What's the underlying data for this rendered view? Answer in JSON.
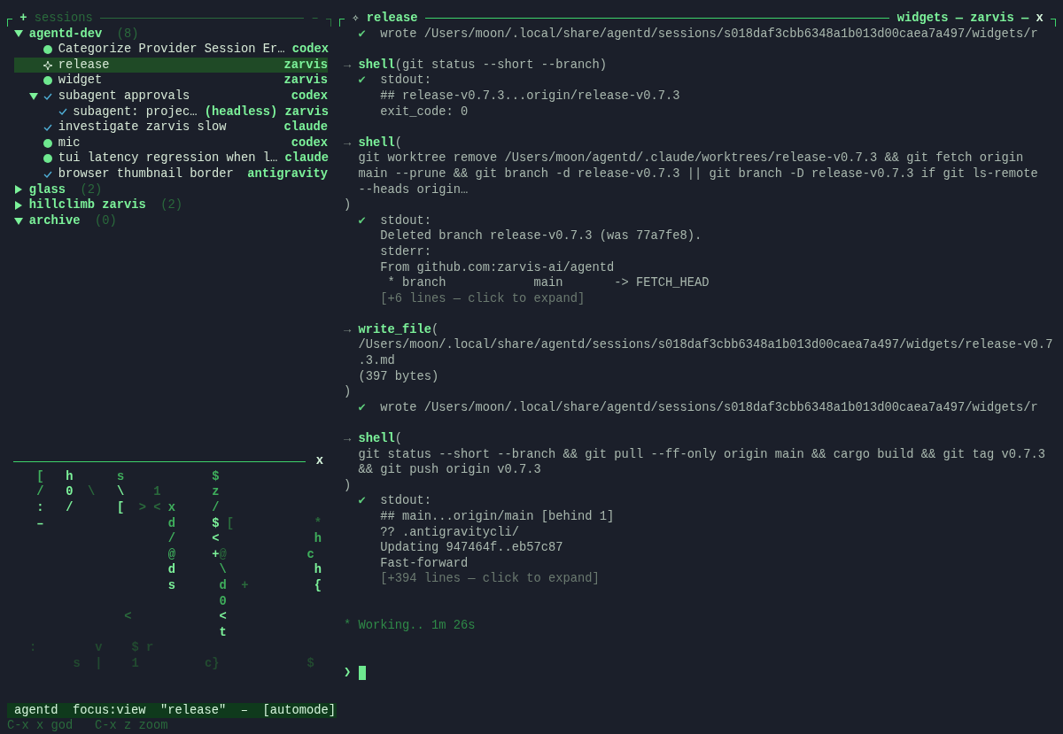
{
  "sessions": {
    "add": "+",
    "title": "sessions",
    "collapse": "–",
    "groups": [
      {
        "name": "agentd-dev",
        "count": "(8)",
        "expanded": true,
        "items": [
          {
            "kind": "running",
            "title": "Categorize Provider Session Er…",
            "agent": "codex",
            "selected": false
          },
          {
            "kind": "active",
            "title": "release",
            "agent": "zarvis",
            "selected": true
          },
          {
            "kind": "running",
            "title": "widget",
            "agent": "zarvis",
            "selected": false
          },
          {
            "kind": "done",
            "title": "subagent approvals",
            "agent": "codex",
            "selected": false,
            "expanded": true,
            "children": [
              {
                "kind": "done",
                "title": "subagent: projec…",
                "tag": "(headless)",
                "agent": "zarvis",
                "selected": false
              }
            ]
          },
          {
            "kind": "done",
            "title": "investigate zarvis slow",
            "agent": "claude",
            "selected": false
          },
          {
            "kind": "running",
            "title": "mic",
            "agent": "codex",
            "selected": false
          },
          {
            "kind": "running",
            "title": "tui latency regression when l…",
            "agent": "claude",
            "selected": false
          },
          {
            "kind": "done",
            "title": "browser thumbnail border",
            "agent": "antigravity",
            "selected": false
          }
        ]
      },
      {
        "name": "glass",
        "count": "(2)",
        "expanded": false
      },
      {
        "name": "hillclimb zarvis",
        "count": "(2)",
        "expanded": false
      },
      {
        "name": "archive",
        "count": "(0)",
        "expanded": true
      }
    ]
  },
  "rain": {
    "close": "x",
    "rows": [
      [
        "",
        "",
        "",
        "",
        "",
        {
          "char": "[",
          "color": "#3fae5c"
        },
        "",
        "",
        "",
        {
          "char": "h",
          "color": "#7cf29a"
        },
        "",
        "",
        "",
        "",
        "",
        "",
        {
          "char": "s",
          "color": "#3fae5c"
        },
        "",
        "",
        "",
        "",
        "",
        "",
        "",
        "",
        "",
        "",
        "",
        "",
        {
          "char": "$",
          "color": "#3fae5c"
        }
      ],
      [
        "",
        "",
        "",
        "",
        "",
        {
          "char": "/",
          "color": "#3fae5c"
        },
        "",
        "",
        "",
        {
          "char": "0",
          "color": "#7cf29a"
        },
        "",
        "",
        {
          "char": "\\",
          "color": "#2a6a3c"
        },
        "",
        "",
        "",
        {
          "char": "\\",
          "color": "#7cf29a"
        },
        "",
        "",
        "",
        "",
        {
          "char": "1",
          "color": "#2a6a3c"
        },
        "",
        "",
        "",
        "",
        "",
        "",
        "",
        {
          "char": "z",
          "color": "#3fae5c"
        }
      ],
      [
        "",
        "",
        "",
        "",
        "",
        {
          "char": ":",
          "color": "#7cf29a"
        },
        "",
        "",
        "",
        {
          "char": "/",
          "color": "#7cf29a"
        },
        "",
        "",
        "",
        "",
        "",
        "",
        {
          "char": "[",
          "color": "#7cf29a"
        },
        "",
        "",
        {
          "char": ">",
          "color": "#2a6a3c"
        },
        "",
        {
          "char": "<",
          "color": "#2a6a3c"
        },
        "",
        {
          "char": "x",
          "color": "#3fae5c"
        },
        "",
        "",
        "",
        "",
        "",
        {
          "char": "/",
          "color": "#3fae5c"
        }
      ],
      [
        "",
        "",
        "",
        "",
        "",
        {
          "char": "–",
          "color": "#7cf29a"
        },
        "",
        "",
        "",
        "",
        "",
        "",
        "",
        "",
        "",
        "",
        "",
        "",
        "",
        "",
        "",
        "",
        "",
        {
          "char": "d",
          "color": "#3fae5c"
        },
        "",
        "",
        "",
        "",
        "",
        {
          "char": "$",
          "color": "#7cf29a"
        },
        "",
        {
          "char": "[",
          "color": "#2a6a3c"
        },
        "",
        "",
        "",
        "",
        "",
        "",
        "",
        "",
        "",
        "",
        "",
        {
          "char": "*",
          "color": "#2a6a3c"
        }
      ],
      [
        "",
        "",
        "",
        "",
        "",
        "",
        "",
        "",
        "",
        "",
        "",
        "",
        "",
        "",
        "",
        "",
        "",
        "",
        "",
        "",
        "",
        "",
        "",
        {
          "char": "/",
          "color": "#3fae5c"
        },
        "",
        "",
        "",
        "",
        "",
        {
          "char": "<",
          "color": "#7cf29a"
        },
        "",
        "",
        "",
        "",
        "",
        "",
        "",
        "",
        "",
        "",
        "",
        "",
        "",
        {
          "char": "h",
          "color": "#3fae5c"
        }
      ],
      [
        "",
        "",
        "",
        "",
        "",
        "",
        "",
        "",
        "",
        "",
        "",
        "",
        "",
        "",
        "",
        "",
        "",
        "",
        "",
        "",
        "",
        "",
        "",
        {
          "char": "@",
          "color": "#3fae5c"
        },
        "",
        "",
        "",
        "",
        "",
        {
          "char": "+",
          "color": "#7cf29a"
        },
        {
          "char": "@",
          "color": "#2a6a3c"
        },
        "",
        "",
        "",
        "",
        "",
        "",
        "",
        "",
        "",
        "",
        "",
        {
          "char": "c",
          "color": "#3fae5c"
        }
      ],
      [
        "",
        "",
        "",
        "",
        "",
        "",
        "",
        "",
        "",
        "",
        "",
        "",
        "",
        "",
        "",
        "",
        "",
        "",
        "",
        "",
        "",
        "",
        "",
        {
          "char": "d",
          "color": "#7cf29a"
        },
        "",
        "",
        "",
        "",
        "",
        "",
        {
          "char": "\\",
          "color": "#3fae5c"
        },
        "",
        "",
        "",
        "",
        "",
        "",
        "",
        "",
        "",
        "",
        "",
        "",
        {
          "char": "h",
          "color": "#7cf29a"
        }
      ],
      [
        "",
        "",
        "",
        "",
        "",
        "",
        "",
        "",
        "",
        "",
        "",
        "",
        "",
        "",
        "",
        "",
        "",
        "",
        "",
        "",
        "",
        "",
        "",
        {
          "char": "s",
          "color": "#7cf29a"
        },
        "",
        "",
        "",
        "",
        "",
        "",
        {
          "char": "d",
          "color": "#3fae5c"
        },
        "",
        "",
        {
          "char": "+",
          "color": "#2a6a3c"
        },
        "",
        "",
        "",
        "",
        "",
        "",
        "",
        "",
        "",
        {
          "char": "{",
          "color": "#7cf29a"
        }
      ],
      [
        "",
        "",
        "",
        "",
        "",
        "",
        "",
        "",
        "",
        "",
        "",
        "",
        "",
        "",
        "",
        "",
        "",
        "",
        "",
        "",
        "",
        "",
        "",
        "",
        "",
        "",
        "",
        "",
        "",
        "",
        {
          "char": "0",
          "color": "#3fae5c"
        }
      ],
      [
        "",
        "",
        "",
        "",
        "",
        "",
        "",
        "",
        "",
        "",
        "",
        "",
        "",
        "",
        "",
        "",
        "",
        {
          "char": "<",
          "color": "#2a6a3c"
        },
        "",
        "",
        "",
        "",
        "",
        "",
        "",
        "",
        "",
        "",
        "",
        "",
        {
          "char": "<",
          "color": "#7cf29a"
        }
      ],
      [
        "",
        "",
        "",
        "",
        "",
        "",
        "",
        "",
        "",
        "",
        "",
        "",
        "",
        "",
        "",
        "",
        "",
        "",
        "",
        "",
        "",
        "",
        "",
        "",
        "",
        "",
        "",
        "",
        "",
        "",
        {
          "char": "t",
          "color": "#7cf29a"
        }
      ],
      [
        "",
        "",
        "",
        "",
        {
          "char": ":",
          "color": "#224a30"
        },
        "",
        "",
        "",
        "",
        "",
        "",
        "",
        "",
        {
          "char": "v",
          "color": "#224a30"
        },
        "",
        "",
        "",
        "",
        {
          "char": "$",
          "color": "#224a30"
        },
        "",
        {
          "char": "r",
          "color": "#224a30"
        }
      ],
      [
        "",
        "",
        "",
        "",
        "",
        "",
        "",
        "",
        "",
        "",
        {
          "char": "s",
          "color": "#224a30"
        },
        "",
        "",
        {
          "char": "|",
          "color": "#224a30"
        },
        "",
        "",
        "",
        "",
        {
          "char": "1",
          "color": "#224a30"
        },
        "",
        "",
        "",
        "",
        "",
        "",
        "",
        "",
        "",
        {
          "char": "c",
          "color": "#224a30"
        },
        {
          "char": "}",
          "color": "#224a30"
        },
        "",
        "",
        "",
        "",
        "",
        "",
        "",
        "",
        "",
        "",
        "",
        "",
        {
          "char": "$",
          "color": "#224a30"
        }
      ]
    ]
  },
  "status_bar": {
    "segments": [
      "agentd",
      "focus:view",
      "\"release\"",
      "–",
      "[automode]"
    ]
  },
  "hints": [
    "C-x x god",
    "C-x z zoom"
  ],
  "view": {
    "header": {
      "icon": "✧",
      "title": "release",
      "meta": [
        "widgets",
        "—",
        "zarvis",
        "—"
      ],
      "close": "x"
    },
    "entries": [
      {
        "kind": "result",
        "marker": "✔",
        "lines": [
          "wrote /Users/moon/.local/share/agentd/sessions/s018daf3cbb6348a1b013d00caea7a497/widgets/r"
        ]
      },
      {
        "kind": "call",
        "marker": "→",
        "name": "shell",
        "head": "(git status --short --branch)"
      },
      {
        "kind": "result",
        "marker": "✔",
        "lines": [
          "stdout:",
          "## release-v0.7.3...origin/release-v0.7.3",
          "exit_code: 0"
        ]
      },
      {
        "kind": "call",
        "marker": "→",
        "name": "shell",
        "head": "(",
        "args": [
          "git worktree remove /Users/moon/agentd/.claude/worktrees/release-v0.7.3 && git fetch origin",
          "main --prune && git branch -d release-v0.7.3 || git branch -D release-v0.7.3 if git ls-remote",
          "--heads origin…"
        ],
        "close": ")"
      },
      {
        "kind": "result",
        "marker": "✔",
        "lines": [
          "stdout:",
          "Deleted branch release-v0.7.3 (was 77a7fe8).",
          "stderr:",
          "From github.com:zarvis-ai/agentd",
          " * branch            main       -> FETCH_HEAD"
        ],
        "more": "[+6 lines — click to expand]"
      },
      {
        "kind": "call",
        "marker": "→",
        "name": "write_file",
        "head": "(",
        "args": [
          "/Users/moon/.local/share/agentd/sessions/s018daf3cbb6348a1b013d00caea7a497/widgets/release-v0.7",
          ".3.md",
          "(397 bytes)"
        ],
        "close": ")"
      },
      {
        "kind": "result",
        "marker": "✔",
        "lines": [
          "wrote /Users/moon/.local/share/agentd/sessions/s018daf3cbb6348a1b013d00caea7a497/widgets/r"
        ]
      },
      {
        "kind": "call",
        "marker": "→",
        "name": "shell",
        "head": "(",
        "args": [
          "git status --short --branch && git pull --ff-only origin main && cargo build && git tag v0.7.3",
          "&& git push origin v0.7.3"
        ],
        "close": ")"
      },
      {
        "kind": "result",
        "marker": "✔",
        "lines": [
          "stdout:",
          "## main...origin/main [behind 1]",
          "?? .antigravitycli/",
          "Updating 947464f..eb57c87",
          "Fast-forward"
        ],
        "more": "[+394 lines — click to expand]"
      }
    ],
    "working": {
      "marker": "*",
      "text": "Working.. 1m 26s"
    },
    "prompt": {
      "marker": "❯"
    }
  }
}
